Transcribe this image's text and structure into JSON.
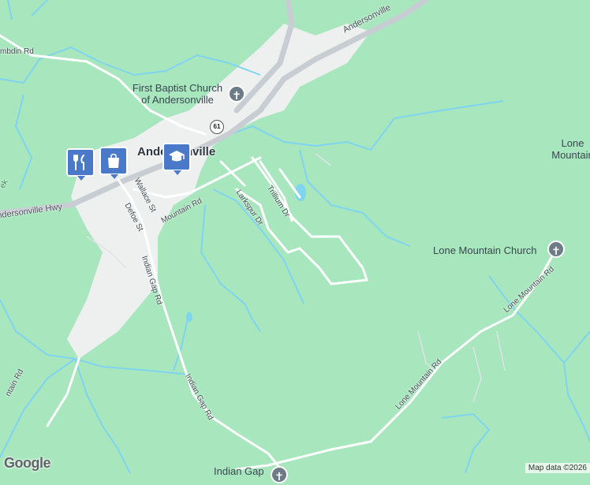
{
  "map": {
    "labels": {
      "church_first_baptist_line1": "First Baptist Church",
      "church_first_baptist_line2": "of Andersonville",
      "town": "Andersonville",
      "lone_mountain_line1": "Lone",
      "lone_mountain_line2": "Mountain",
      "lone_mountain_church": "Lone Mountain Church",
      "indian_gap": "Indian Gap"
    },
    "roads": {
      "andersonville_hwy_ne": "Andersonville",
      "andersonville_hwy_w": "ndersonville Hwy",
      "lambdin": "mbdin Rd",
      "route_61": "61",
      "wallace": "Wallace St",
      "defoe": "Defoe St",
      "mountain": "Mountain Rd",
      "larkspur": "Larkspur Dr",
      "trillium": "Trillium Dr",
      "indian_gap_rd_1": "Indian Gap Rd",
      "indian_gap_rd_2": "Indian Gap Rd",
      "lone_mountain_rd_1": "Lone Mountain Rd",
      "lone_mountain_rd_2": "Lone Mountain Rd",
      "mountain_rd_sw": "ntain Rd",
      "creek_w": "ek"
    },
    "pins": [
      {
        "name": "restaurant",
        "icon": "fork-knife-icon"
      },
      {
        "name": "shopping",
        "icon": "shopping-bag-icon"
      },
      {
        "name": "school",
        "icon": "graduation-cap-icon"
      }
    ],
    "colors": {
      "land": "#a8e6bd",
      "town_area": "#eef0f0",
      "water": "#7fd4f0",
      "road": "#ffffff",
      "highway": "#c8cdd3",
      "pin": "#4a79c9"
    }
  },
  "footer": {
    "logo": "Google",
    "attribution": "Map data ©2026"
  }
}
